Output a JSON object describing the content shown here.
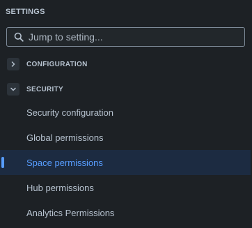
{
  "panel": {
    "title": "SETTINGS"
  },
  "search": {
    "placeholder": "Jump to setting...",
    "icon": "search-icon"
  },
  "sections": [
    {
      "label": "CONFIGURATION",
      "state": "collapsed",
      "icon": "chevron-right-icon"
    },
    {
      "label": "SECURITY",
      "state": "expanded",
      "icon": "chevron-down-icon"
    }
  ],
  "security_items": [
    {
      "label": "Security configuration",
      "selected": false
    },
    {
      "label": "Global permissions",
      "selected": false
    },
    {
      "label": "Space permissions",
      "selected": true
    },
    {
      "label": "Hub permissions",
      "selected": false
    },
    {
      "label": "Analytics Permissions",
      "selected": false
    }
  ],
  "colors": {
    "background": "#1d2125",
    "text": "#b6c2cf",
    "selected_bg": "#1c2b41",
    "accent": "#579dff",
    "border": "#7e8b99"
  }
}
